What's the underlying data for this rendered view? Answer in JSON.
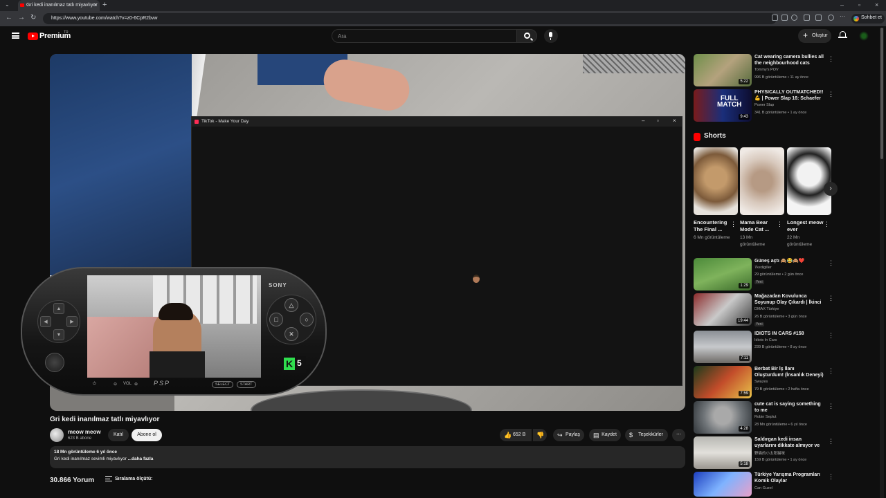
{
  "browser": {
    "tab_title": "Gri kedi inanılmaz tatlı miyavlıyor",
    "url": "https://www.youtube.com/watch?v=z0-6CpR2bvw",
    "chat_label": "Sohbet et"
  },
  "header": {
    "logo_text": "Premium",
    "logo_tm": "TR",
    "search_placeholder": "Ara",
    "create_label": "Oluştur"
  },
  "tiktok": {
    "window_title": "TikTok - Make Your Day"
  },
  "psp": {
    "brand": "SONY",
    "vol_label": "VOL",
    "logo": "PSP",
    "select_label": "SELECT",
    "start_label": "START",
    "kick_badge": "K",
    "kick_count": "5"
  },
  "video": {
    "title": "Gri kedi inanılmaz tatlı miyavlıyor",
    "channel": "meow meow",
    "subscribers": "623 B abone",
    "join_label": "Katıl",
    "subscribe_label": "Abone ol",
    "likes": "652 B",
    "share_label": "Paylaş",
    "save_label": "Kaydet",
    "thanks_label": "Teşekkürler",
    "stats": "18 Mn görüntüleme  6 yıl önce",
    "description": "Gri kedi inanılmaz sevimli miyavlıyor",
    "more_label": "...daha fazla",
    "comments_count": "30.866 Yorum",
    "sort_label": "Sıralama ölçütü:"
  },
  "sidebar": {
    "top_recs": [
      {
        "title": "Cat wearing camera bullies all the neighbourhood cats",
        "channel": "Tommy's POV",
        "meta": "996 B görüntüleme • 11 ay önce",
        "duration": "5:22"
      },
      {
        "title": "PHYSICALLY OUTMATCHED!! 💪 | Power Slap 16: Schaefer ...",
        "channel": "Power Slap",
        "meta": "341 B görüntüleme • 1 ay önce",
        "duration": "9:43"
      }
    ],
    "shorts_title": "Shorts",
    "shorts": [
      {
        "title": "Encountering The Final ...",
        "views": "6 Mn görüntüleme"
      },
      {
        "title": "Mama Bear Mode Cat ...",
        "views": "13 Mn görüntüleme"
      },
      {
        "title": "Longest meow ever",
        "views": "22 Mn görüntüleme"
      }
    ],
    "recs": [
      {
        "title": "Güneş açtı 🙈😂🙈❤️",
        "channel": "7kedigiller",
        "meta": "29 görüntüleme • 2 gün önce",
        "badge": "Yeni",
        "duration": "1:29"
      },
      {
        "title": "Mağazadan Kovulunca Soyunup Olay Çıkardı | İkinci El Kralları (...",
        "channel": "DMAX Türkiye",
        "meta": "26 B görüntüleme • 3 gün önce",
        "badge": "Yeni",
        "duration": "19:44"
      },
      {
        "title": "IDIOTS IN CARS #158",
        "channel": "Idiots In Cars",
        "meta": "239 B görüntüleme • 8 ay önce",
        "badge": "",
        "duration": "7:11"
      },
      {
        "title": "Berbat Bir İş İlanı Oluşturdum! (İnsanlık Deneyi)",
        "channel": "Swazes",
        "meta": "79 B görüntüleme • 2 hafta önce",
        "badge": "",
        "duration": "7:59"
      },
      {
        "title": "cute cat is saying something to me",
        "channel": "Robin Seplut",
        "meta": "28 Mn görüntüleme • 6 yıl önce",
        "badge": "",
        "duration": "4:28"
      },
      {
        "title": "Saldırgan kedi insan uyarlarını dikkate almıyor ve diğer ...",
        "channel": "野猫的小太阳猫咪",
        "meta": "159 B görüntüleme • 1 ay önce",
        "badge": "",
        "duration": "5:18"
      },
      {
        "title": "Türkiye Yarışma Programları Komik Olaylar",
        "channel": "Can Guzel",
        "meta": "",
        "badge": "",
        "duration": ""
      }
    ]
  }
}
